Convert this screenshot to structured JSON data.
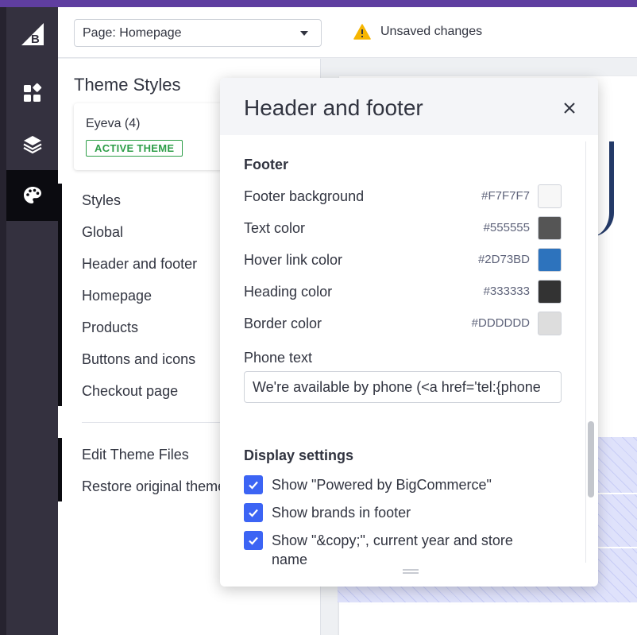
{
  "app": {
    "brand": "BigCommerce",
    "accent": "#5f3ea0"
  },
  "leftnav": {
    "items": [
      {
        "name": "dashboard-icon"
      },
      {
        "name": "layers-icon"
      },
      {
        "name": "palette-icon",
        "active": true
      }
    ]
  },
  "toolbar": {
    "page_select": "Page: Homepage",
    "status": "Unsaved changes",
    "status_icon": "warning-icon"
  },
  "sidebar": {
    "title": "Theme Styles",
    "theme_name": "Eyeva (4)",
    "theme_badge": "ACTIVE THEME",
    "items": [
      "Styles",
      "Global",
      "Header and footer",
      "Homepage",
      "Products",
      "Buttons and icons",
      "Checkout page"
    ],
    "secondary": [
      "Edit Theme Files",
      "Restore original theme"
    ]
  },
  "modal": {
    "title": "Header and footer",
    "section_footer": "Footer",
    "colors": [
      {
        "label": "Footer background",
        "hex": "#F7F7F7"
      },
      {
        "label": "Text color",
        "hex": "#555555"
      },
      {
        "label": "Hover link color",
        "hex": "#2D73BD"
      },
      {
        "label": "Heading color",
        "hex": "#333333"
      },
      {
        "label": "Border color",
        "hex": "#DDDDDD"
      }
    ],
    "phone_label": "Phone text",
    "phone_value": "We're available by phone (<a href='tel:{phone",
    "section_display": "Display settings",
    "checks": [
      {
        "label": "Show \"Powered by BigCommerce\"",
        "checked": true
      },
      {
        "label": "Show brands in footer",
        "checked": true
      },
      {
        "label": "Show \"&copy;\", current year and store name",
        "checked": true
      }
    ]
  }
}
